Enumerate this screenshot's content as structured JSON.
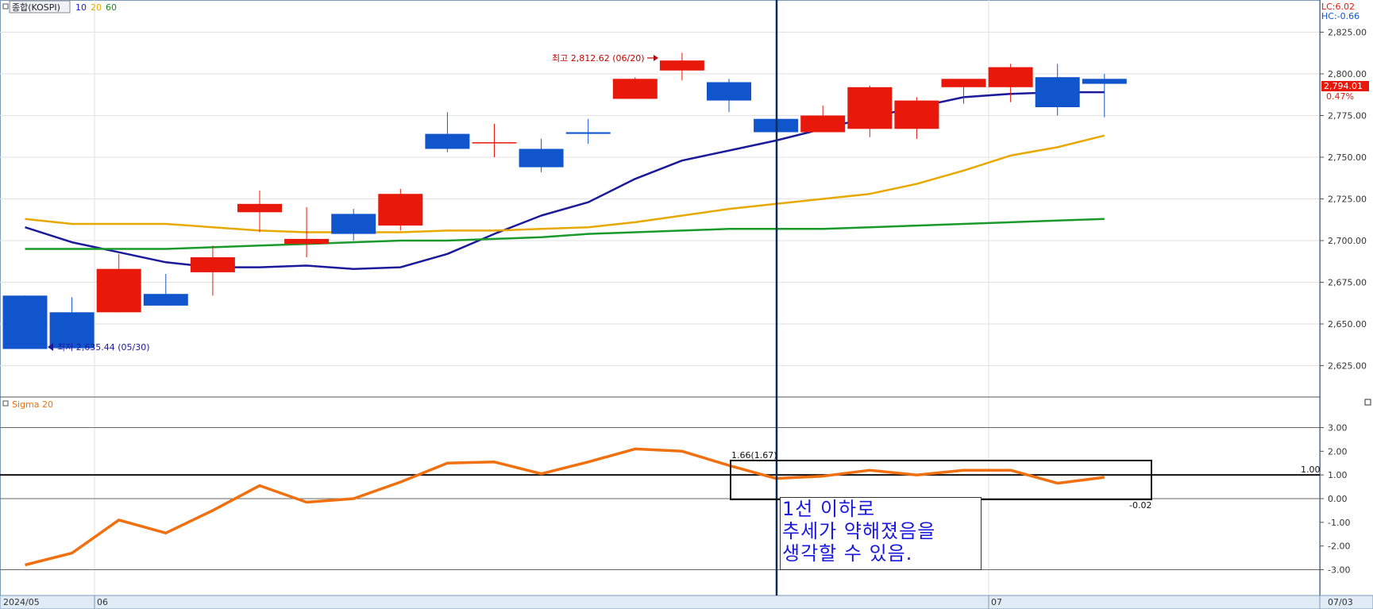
{
  "header": {
    "symbol": "종합(KOSPI)",
    "ma_labels": [
      {
        "label": "10",
        "color": "#1818e0"
      },
      {
        "label": "20",
        "color": "#e8a800"
      },
      {
        "label": "60",
        "color": "#1a8a1a"
      }
    ],
    "lc_label": "LC:6.02",
    "hc_label": "HC:-0.66"
  },
  "price_panel": {
    "current_price": "2,794.01",
    "change_pct": "0.47%",
    "high_annotation": "최고 2,812.62 (06/20)",
    "low_annotation": "최저 2,635.44 (05/30)"
  },
  "sigma_panel": {
    "title": "Sigma 20",
    "marker_value": "1.66(1.67)",
    "line_label": "1.00",
    "last_value": "-0.02"
  },
  "annotation_box": {
    "lines": [
      "1선 이하로",
      "추세가 약해졌음을",
      "생각할 수 있음."
    ]
  },
  "date_axis": {
    "labels": [
      {
        "text": "2024/05",
        "pos": "left"
      },
      {
        "text": "06",
        "pos": "june"
      },
      {
        "text": "07",
        "pos": "july"
      },
      {
        "text": "07/03",
        "pos": "right"
      }
    ]
  },
  "colors": {
    "up": "#e8190a",
    "down": "#1155cc",
    "ma10": "#1a1a9a",
    "ma20": "#e8a800",
    "ma60": "#1a9a2a",
    "sigma": "#f07010",
    "annotation_text": "#1818e0"
  },
  "chart_data": [
    {
      "type": "candlestick",
      "title": "종합(KOSPI)",
      "y_axis_ticks": [
        2625,
        2650,
        2675,
        2700,
        2725,
        2750,
        2775,
        2800,
        2825
      ],
      "ylim": [
        2602,
        2840
      ],
      "candles": [
        {
          "open": 2667,
          "high": 2667,
          "low": 2635,
          "close": 2635
        },
        {
          "open": 2657,
          "high": 2666,
          "low": 2635,
          "close": 2635.44
        },
        {
          "open": 2657,
          "high": 2692,
          "low": 2657,
          "close": 2683
        },
        {
          "open": 2668,
          "high": 2680,
          "low": 2661,
          "close": 2661
        },
        {
          "open": 2681,
          "high": 2697,
          "low": 2667,
          "close": 2690
        },
        {
          "open": 2717,
          "high": 2730,
          "low": 2705,
          "close": 2722
        },
        {
          "open": 2698,
          "high": 2720,
          "low": 2690,
          "close": 2701
        },
        {
          "open": 2716,
          "high": 2719,
          "low": 2700,
          "close": 2704
        },
        {
          "open": 2709,
          "high": 2731,
          "low": 2706,
          "close": 2728
        },
        {
          "open": 2764,
          "high": 2777,
          "low": 2753,
          "close": 2755
        },
        {
          "open": 2759,
          "high": 2770,
          "low": 2750,
          "close": 2759
        },
        {
          "open": 2755,
          "high": 2761,
          "low": 2741,
          "close": 2744
        },
        {
          "open": 2765,
          "high": 2773,
          "low": 2758,
          "close": 2764
        },
        {
          "open": 2785,
          "high": 2798,
          "low": 2785,
          "close": 2797
        },
        {
          "open": 2802,
          "high": 2812.62,
          "low": 2796,
          "close": 2808
        },
        {
          "open": 2795,
          "high": 2797,
          "low": 2777,
          "close": 2784
        },
        {
          "open": 2773,
          "high": 2773,
          "low": 2765,
          "close": 2765
        },
        {
          "open": 2765,
          "high": 2781,
          "low": 2765,
          "close": 2775
        },
        {
          "open": 2767,
          "high": 2793,
          "low": 2762,
          "close": 2792
        },
        {
          "open": 2767,
          "high": 2786,
          "low": 2761,
          "close": 2784
        },
        {
          "open": 2792,
          "high": 2797,
          "low": 2782,
          "close": 2797
        },
        {
          "open": 2792,
          "high": 2806,
          "low": 2783,
          "close": 2804
        },
        {
          "open": 2798,
          "high": 2806,
          "low": 2775,
          "close": 2780
        },
        {
          "open": 2797,
          "high": 2800,
          "low": 2774,
          "close": 2794.01
        }
      ],
      "series": [
        {
          "name": "10",
          "values": [
            2708,
            2699,
            2693,
            2687,
            2684,
            2684,
            2685,
            2683,
            2684,
            2692,
            2704,
            2715,
            2723,
            2737,
            2748,
            2754,
            2760,
            2767,
            2774,
            2780,
            2786,
            2788,
            2789,
            2789
          ]
        },
        {
          "name": "20",
          "values": [
            2713,
            2710,
            2710,
            2710,
            2708,
            2706,
            2705,
            2705,
            2705,
            2706,
            2706,
            2707,
            2708,
            2711,
            2715,
            2719,
            2722,
            2725,
            2728,
            2734,
            2742,
            2751,
            2756,
            2763
          ]
        },
        {
          "name": "60",
          "values": [
            2695,
            2695,
            2695,
            2695,
            2696,
            2697,
            2698,
            2699,
            2700,
            2700,
            2701,
            2702,
            2704,
            2705,
            2706,
            2707,
            2707,
            2707,
            2708,
            2709,
            2710,
            2711,
            2712,
            2713
          ]
        }
      ]
    },
    {
      "type": "line",
      "title": "Sigma 20",
      "y_axis_ticks": [
        -3,
        -2,
        -1,
        0,
        1,
        2,
        3
      ],
      "ylim": [
        -3.6,
        3.9
      ],
      "reference_lines": [
        3,
        1,
        0,
        -3
      ],
      "series": [
        {
          "name": "Sigma 20",
          "values": [
            -2.8,
            -2.3,
            -0.9,
            -1.45,
            -0.5,
            0.55,
            -0.15,
            0.0,
            0.7,
            1.5,
            1.55,
            1.05,
            1.55,
            2.1,
            2.0,
            1.4,
            0.85,
            0.95,
            1.2,
            1.0,
            1.2,
            1.2,
            0.65,
            0.9
          ]
        }
      ]
    }
  ]
}
